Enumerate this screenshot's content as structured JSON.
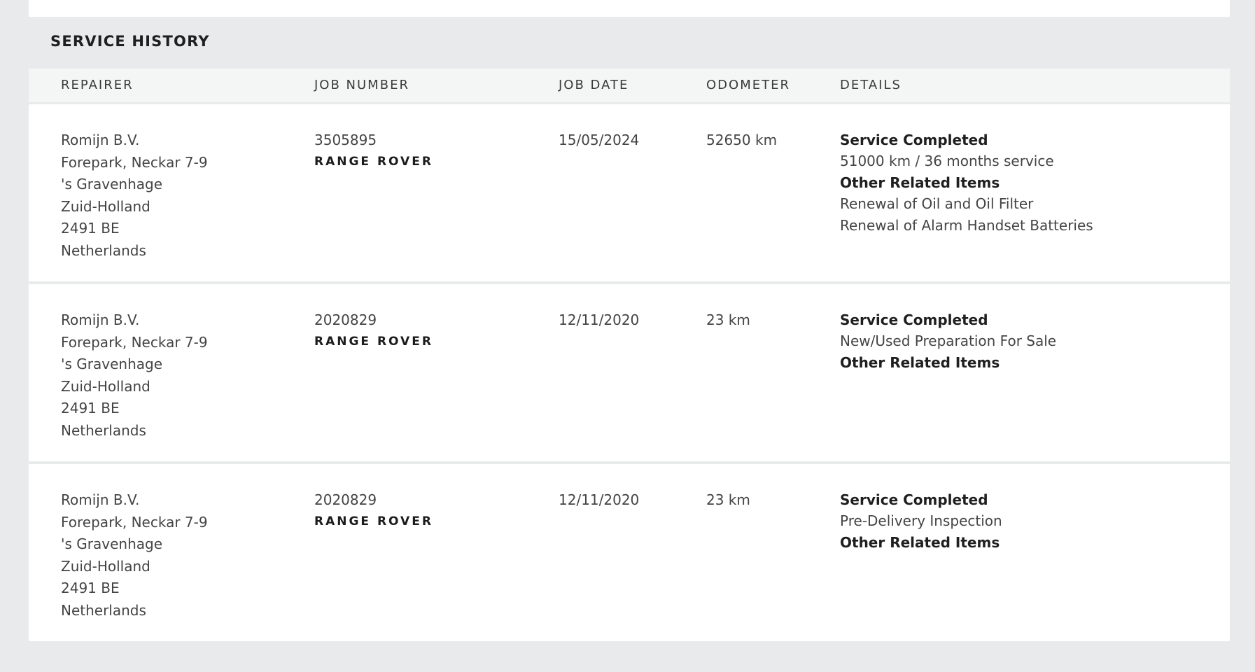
{
  "section": {
    "title": "SERVICE HISTORY"
  },
  "columns": {
    "repairer": "REPAIRER",
    "job_number": "JOB NUMBER",
    "job_date": "JOB DATE",
    "odometer": "ODOMETER",
    "details": "DETAILS"
  },
  "rows": [
    {
      "repairer": [
        "Romijn B.V.",
        "Forepark, Neckar 7-9",
        "'s Gravenhage",
        "Zuid-Holland",
        "2491 BE",
        "Netherlands"
      ],
      "job_number": "3505895",
      "brand": "RANGE ROVER",
      "job_date": "15/05/2024",
      "odometer": "52650 km",
      "details": {
        "heading1": "Service Completed",
        "service": "51000 km / 36 months service",
        "heading2": "Other Related Items",
        "items": [
          "Renewal of Oil and Oil Filter",
          "Renewal of Alarm Handset Batteries"
        ]
      }
    },
    {
      "repairer": [
        "Romijn B.V.",
        "Forepark, Neckar 7-9",
        "'s Gravenhage",
        "Zuid-Holland",
        "2491 BE",
        "Netherlands"
      ],
      "job_number": "2020829",
      "brand": "RANGE ROVER",
      "job_date": "12/11/2020",
      "odometer": "23 km",
      "details": {
        "heading1": "Service Completed",
        "service": "New/Used Preparation For Sale",
        "heading2": "Other Related Items",
        "items": []
      }
    },
    {
      "repairer": [
        "Romijn B.V.",
        "Forepark, Neckar 7-9",
        "'s Gravenhage",
        "Zuid-Holland",
        "2491 BE",
        "Netherlands"
      ],
      "job_number": "2020829",
      "brand": "RANGE ROVER",
      "job_date": "12/11/2020",
      "odometer": "23 km",
      "details": {
        "heading1": "Service Completed",
        "service": "Pre-Delivery Inspection",
        "heading2": "Other Related Items",
        "items": []
      }
    }
  ]
}
